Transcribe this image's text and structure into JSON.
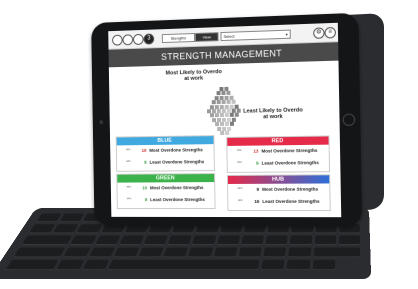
{
  "colors": {
    "blue": "#3fa9e0",
    "red": "#e52a4a",
    "green": "#3bb24a",
    "hub_gradient": [
      "#e52a4a",
      "#2e6fd8"
    ],
    "banner": "#4a4a4a",
    "count_high": "#d22f2f",
    "count_low": "#3a9a40"
  },
  "topbar": {
    "icons": [
      "circle-icon",
      "circle-icon",
      "circle-icon",
      "number-icon"
    ],
    "number_badge": "3",
    "tabs": [
      "Stengths",
      "View"
    ],
    "select_value": "Select",
    "right_icons": [
      "settings-icon",
      "menu-icon"
    ]
  },
  "banner": {
    "title": "STRENGTH MANAGEMENT"
  },
  "graphic": {
    "top_label": "Most Likely to Overdo at work",
    "bottom_label": "Least Likely to Overdo at work"
  },
  "panels": {
    "blue": {
      "title": "BLUE",
      "most": {
        "mini": "abc",
        "count": "10",
        "label": "Most Overdone Strengths"
      },
      "least": {
        "mini": "abc",
        "count": "8",
        "label": "Least Overdone Strengths"
      }
    },
    "red": {
      "title": "RED",
      "most": {
        "mini": "abc",
        "count": "13",
        "label": "Most Overdone Strengths"
      },
      "least": {
        "mini": "abc",
        "count": "9",
        "label": "Least Overdone Strengths"
      }
    },
    "green": {
      "title": "GREEN",
      "most": {
        "mini": "abc",
        "count": "10",
        "label": "Most Overdone Strengths"
      },
      "least": {
        "mini": "abc",
        "count": "8",
        "label": "Least Overdone Strengths"
      }
    },
    "hub": {
      "title": "HUB",
      "most": {
        "mini": "abc",
        "count": "9",
        "label": "Most Overdone Strengths"
      },
      "least": {
        "mini": "abc",
        "count": "16",
        "label": "Least Overdone Strengths"
      }
    }
  }
}
